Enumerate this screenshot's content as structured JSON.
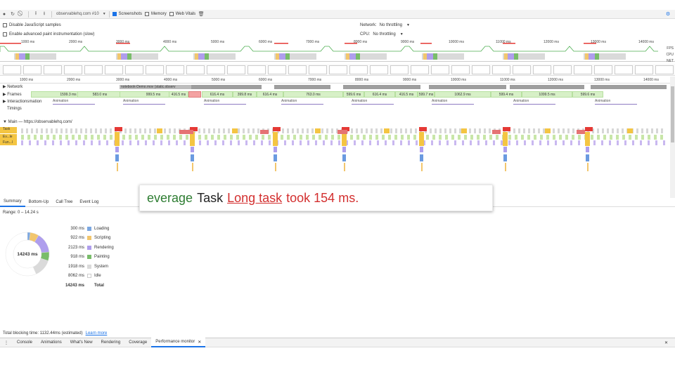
{
  "toolbar": {
    "url": "observablehq.com #10",
    "screenshots_label": "Screenshots",
    "memory_label": "Memory",
    "web_vitals_label": "Web Vitals"
  },
  "options": {
    "disable_js_samples": "Disable JavaScript samples",
    "advanced_paint": "Enable advanced paint instrumentation (slow)",
    "network_label": "Network:",
    "network_value": "No throttling",
    "cpu_label": "CPU:",
    "cpu_value": "No throttling"
  },
  "overview": {
    "ticks": [
      "1000 ms",
      "2000 ms",
      "3000 ms",
      "4000 ms",
      "5000 ms",
      "6000 ms",
      "7000 ms",
      "8000 ms",
      "9000 ms",
      "10000 ms",
      "11000 ms",
      "12000 ms",
      "13000 ms",
      "14000 ms"
    ],
    "side_labels": [
      "FPS",
      "CPU",
      "NET"
    ]
  },
  "ruler": {
    "ticks": [
      "1000 ms",
      "2000 ms",
      "3000 ms",
      "4000 ms",
      "5000 ms",
      "6000 ms",
      "7000 ms",
      "8000 ms",
      "9000 ms",
      "10000 ms",
      "11000 ms",
      "12000 ms",
      "13000 ms",
      "14000 ms"
    ]
  },
  "tracks": {
    "network": "Network",
    "network_request": "notebook-Demo.mov (static.observ",
    "frames": "Frames",
    "interactions": "Interactions",
    "interactions_overlay": "mation",
    "timings": "Timings",
    "main": "Main — https://observablehq.com/",
    "flame_task": "Task",
    "flame_ev": "Ev...le",
    "flame_fun": "Fun...l",
    "frames_list": [
      "1599.3 ms",
      "583.0 ms",
      "999.5 ms",
      "416.5 ms",
      "",
      "616.4 ms",
      "399.8 ms",
      "616.4 ms",
      "763.0 ms",
      "599.6 ms",
      "616.4 ms",
      "416.5 ms",
      "599.7 ms",
      "1062.9 ms",
      "599.4 ms",
      "1099.5 ms",
      "599.6 ms"
    ],
    "animation_label": "Animation"
  },
  "tooltip": {
    "prefix": "everage",
    "task_word": "Task",
    "link": "Long task",
    "suffix": "took 154 ms."
  },
  "bottom_tabs": [
    "Summary",
    "Bottom-Up",
    "Call Tree",
    "Event Log"
  ],
  "summary": {
    "range": "Range: 0 – 14.24 s",
    "donut_total": "14243 ms",
    "legend": [
      {
        "value": "300 ms",
        "label": "Loading",
        "color": "#7ba7e1"
      },
      {
        "value": "922 ms",
        "label": "Scripting",
        "color": "#f2c66d"
      },
      {
        "value": "2123 ms",
        "label": "Rendering",
        "color": "#af9eed"
      },
      {
        "value": "918 ms",
        "label": "Painting",
        "color": "#79bd6a"
      },
      {
        "value": "1918 ms",
        "label": "System",
        "color": "#dadada"
      },
      {
        "value": "8062 ms",
        "label": "Idle",
        "color": "#ffffff"
      },
      {
        "value": "14243 ms",
        "label": "Total",
        "color": ""
      }
    ]
  },
  "status": {
    "blocking": "Total blocking time: 1132.44ms (estimated)",
    "learn_more": "Learn more"
  },
  "drawer_tabs": [
    "Console",
    "Animations",
    "What's New",
    "Rendering",
    "Coverage",
    "Performance monitor"
  ]
}
